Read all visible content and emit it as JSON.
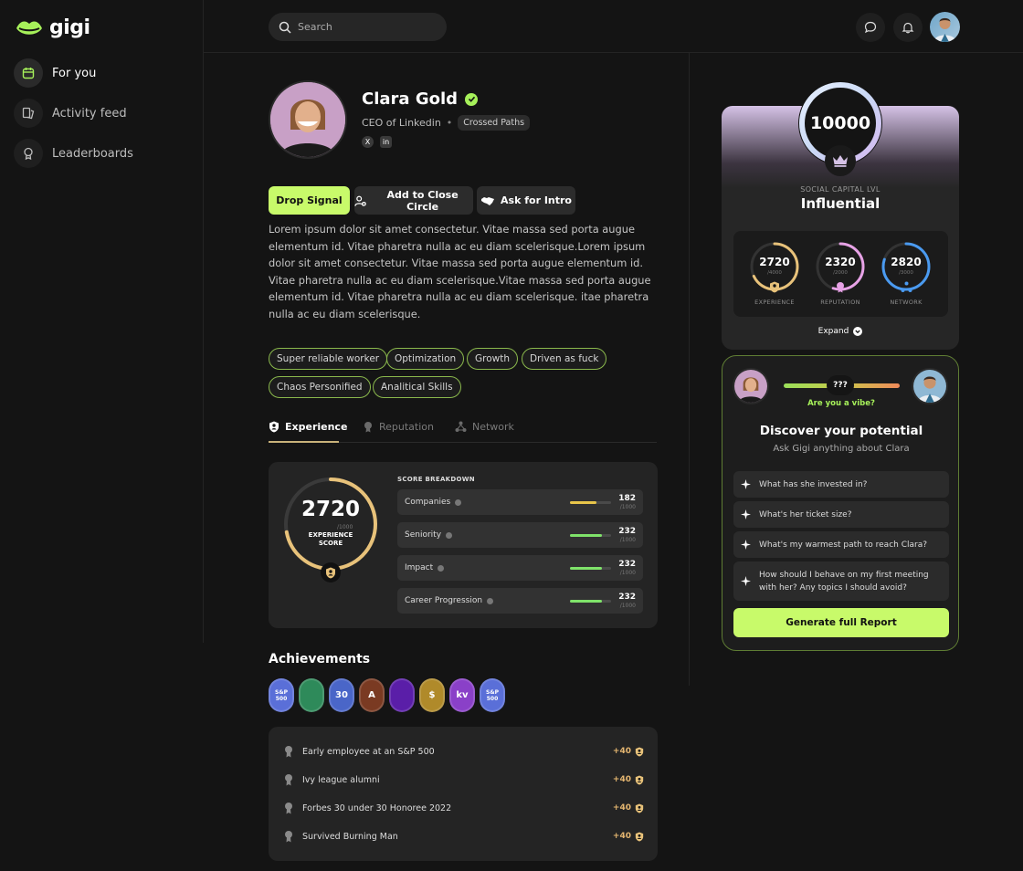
{
  "app": {
    "name": "gigi"
  },
  "sidebar": {
    "items": [
      {
        "label": "For you",
        "icon": "calendar-icon",
        "active": true
      },
      {
        "label": "Activity feed",
        "icon": "feed-icon"
      },
      {
        "label": "Leaderboards",
        "icon": "trophy-icon"
      }
    ]
  },
  "search": {
    "placeholder": "Search"
  },
  "profile": {
    "name": "Clara Gold",
    "title": "CEO of Linkedin",
    "badge": "Crossed Paths",
    "social": [
      "X",
      "in"
    ],
    "bio": "Lorem ipsum dolor sit amet consectetur. Vitae massa sed porta augue elementum id. Vitae pharetra nulla ac eu diam scelerisque.Lorem ipsum dolor sit amet consectetur. Vitae massa sed porta augue elementum id. Vitae pharetra nulla ac eu diam scelerisque.Vitae massa sed porta augue elementum id. Vitae pharetra nulla ac eu diam scelerisque. itae pharetra nulla ac eu diam scelerisque."
  },
  "actions": {
    "drop_signal": "Drop Signal",
    "add_close_circle": "Add to Close Circle",
    "ask_intro": "Ask for Intro"
  },
  "tags": [
    "Super reliable worker",
    "Optimization",
    "Growth",
    "Driven as fuck",
    "Chaos Personified",
    "Analitical Skills"
  ],
  "tabs": [
    {
      "label": "Experience",
      "active": true
    },
    {
      "label": "Reputation"
    },
    {
      "label": "Network"
    }
  ],
  "experience": {
    "score": "2720",
    "max": "/1000",
    "label_line1": "EXPERIENCE",
    "label_line2": "SCORE",
    "ring_fraction": 0.72,
    "breakdown_title": "SCORE BREAKDOWN",
    "rows": [
      {
        "label": "Companies",
        "value": "182",
        "max": "/1000",
        "fill": 0.65,
        "color": "#e8c54a"
      },
      {
        "label": "Seniority",
        "value": "232",
        "max": "/1000",
        "fill": 0.78,
        "color": "#7fe36a"
      },
      {
        "label": "Impact",
        "value": "232",
        "max": "/1000",
        "fill": 0.78,
        "color": "#7fe36a"
      },
      {
        "label": "Career Progression",
        "value": "232",
        "max": "/1000",
        "fill": 0.78,
        "color": "#7fe36a"
      }
    ]
  },
  "achievements": {
    "title": "Achievements",
    "medals": [
      {
        "text": "S&P 500",
        "color": "#5a6fd8"
      },
      {
        "text": "",
        "color": "#2e8a5a"
      },
      {
        "text": "30",
        "color": "#4a66c8"
      },
      {
        "text": "A",
        "color": "#7a3a22"
      },
      {
        "text": "",
        "color": "#5a1ea8"
      },
      {
        "text": "$",
        "color": "#b08a2a"
      },
      {
        "text": "kv",
        "color": "#8a40c8"
      },
      {
        "text": "S&P 500",
        "color": "#5a6fd8"
      }
    ],
    "list": [
      {
        "text": "Early employee at an S&P 500",
        "points": "+40"
      },
      {
        "text": "Ivy league alumni",
        "points": "+40"
      },
      {
        "text": "Forbes 30 under 30 Honoree 2022",
        "points": "+40"
      },
      {
        "text": "Survived Burning Man",
        "points": "+40"
      }
    ]
  },
  "social_capital": {
    "score": "10000",
    "level_label": "SOCIAL CAPITAL LVL",
    "level": "Influential",
    "expand": "Expand",
    "minis": [
      {
        "value": "2720",
        "max": "/4000",
        "label": "EXPERIENCE",
        "fraction": 0.68,
        "color": "#e8c27a"
      },
      {
        "value": "2320",
        "max": "/2000",
        "label": "REPUTATION",
        "fraction": 0.55,
        "color": "#e7a2e6"
      },
      {
        "value": "2820",
        "max": "/3000",
        "label": "NETWORK",
        "fraction": 0.8,
        "color": "#4a9af0"
      }
    ]
  },
  "vibe": {
    "unknown": "???",
    "caption": "Are you a vibe?",
    "title": "Discover your potential",
    "subtitle": "Ask Gigi anything about Clara",
    "questions": [
      "What has she invested in?",
      "What's her ticket size?",
      "What's my warmest path to reach Clara?",
      "How should I behave on my first meeting with her? Any topics I should avoid?"
    ],
    "generate": "Generate full Report"
  }
}
